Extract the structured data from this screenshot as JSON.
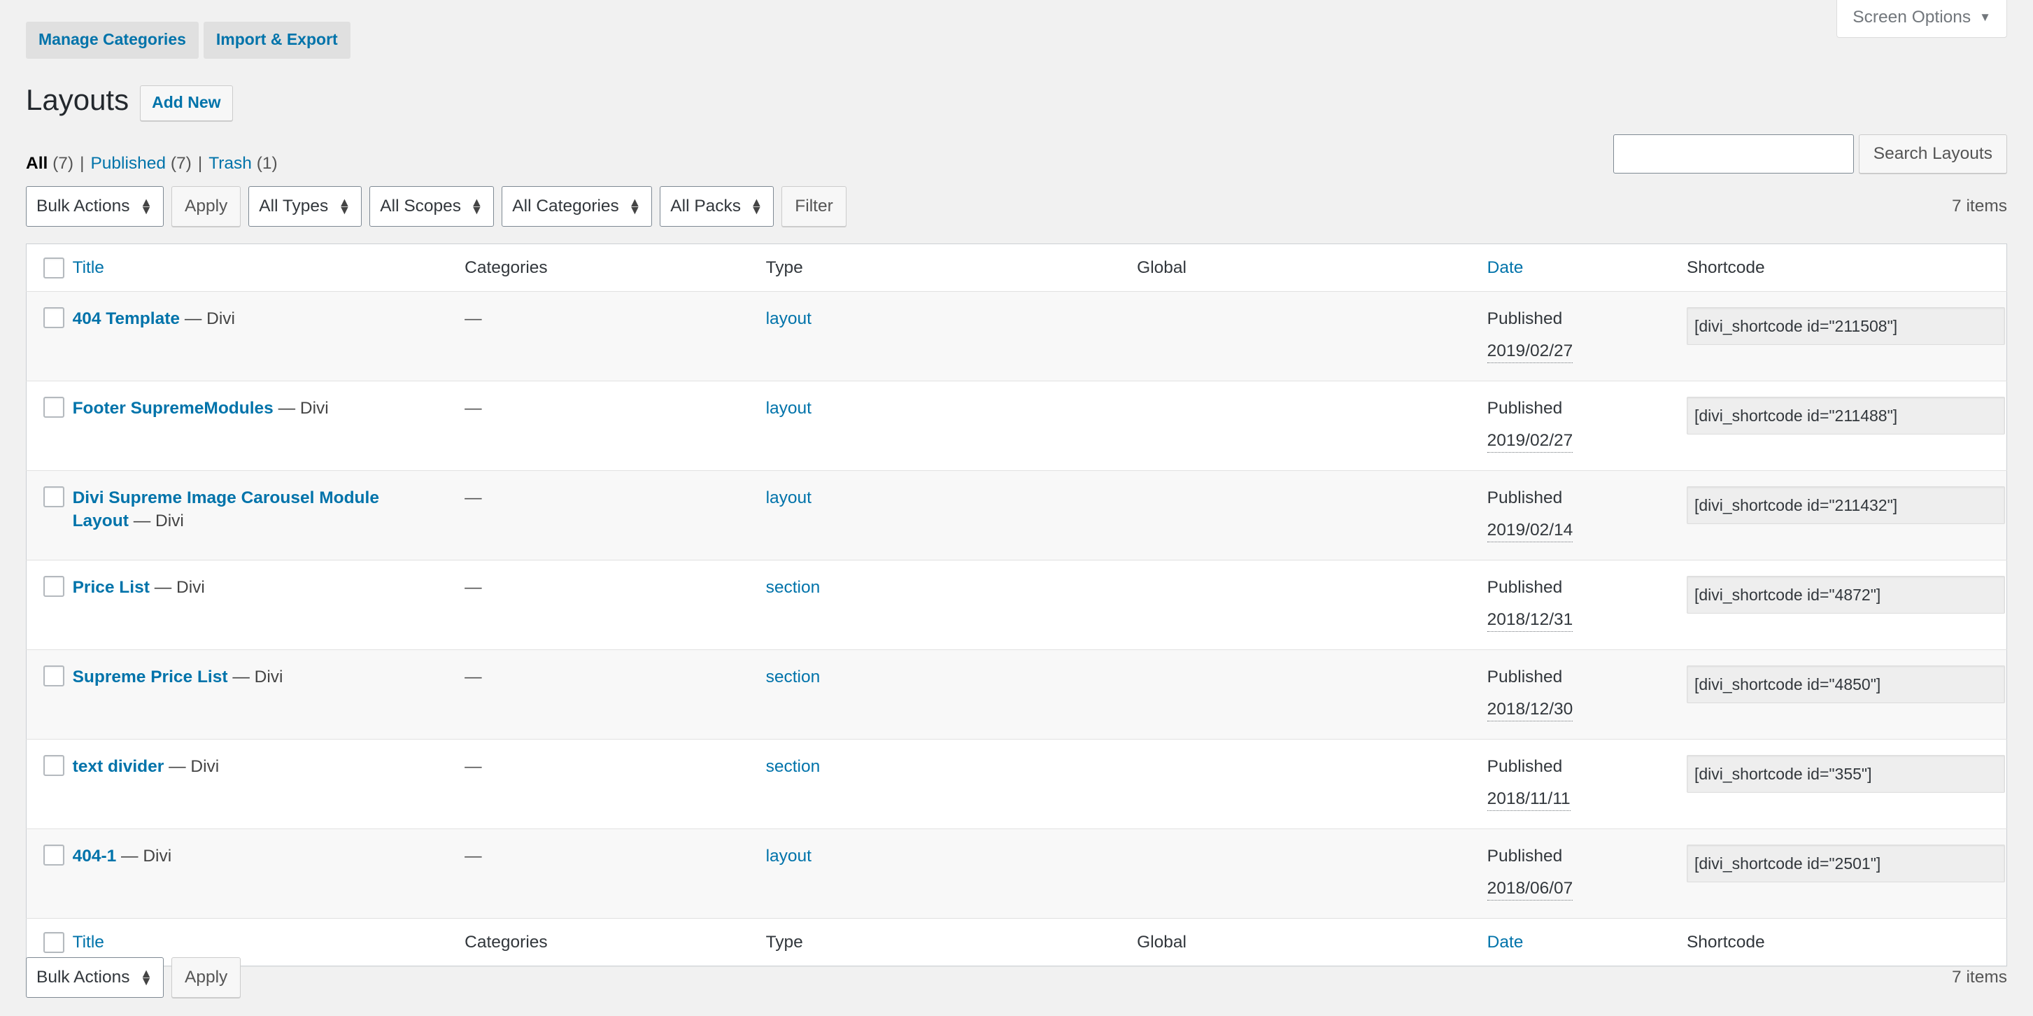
{
  "screen_options": {
    "label": "Screen Options",
    "caret": "▼"
  },
  "top_actions": [
    {
      "label": "Manage Categories",
      "name": "manage-categories-button"
    },
    {
      "label": "Import & Export",
      "name": "import-export-button"
    }
  ],
  "page_title": "Layouts",
  "add_new_label": "Add New",
  "status_links": [
    {
      "label": "All",
      "count": "(7)",
      "current": true
    },
    {
      "label": "Published",
      "count": "(7)",
      "current": false
    },
    {
      "label": "Trash",
      "count": "(1)",
      "current": false
    }
  ],
  "separator": "|",
  "search": {
    "value": "",
    "placeholder": "",
    "submit_label": "Search Layouts"
  },
  "tablenav_top": {
    "bulk_actions_label": "Bulk Actions",
    "apply_label": "Apply",
    "types_label": "All Types",
    "scopes_label": "All Scopes",
    "categories_label": "All Categories",
    "packs_label": "All Packs",
    "filter_label": "Filter",
    "item_count": "7 items"
  },
  "tablenav_bottom": {
    "bulk_actions_label": "Bulk Actions",
    "apply_label": "Apply",
    "item_count": "7 items"
  },
  "columns": {
    "title": "Title",
    "categories": "Categories",
    "type": "Type",
    "global": "Global",
    "date": "Date",
    "shortcode": "Shortcode"
  },
  "rows": [
    {
      "title": "404 Template",
      "post_state": "— Divi",
      "categories": "—",
      "type": "layout",
      "global": "",
      "date_status": "Published",
      "date_value": "2019/02/27",
      "shortcode": "[divi_shortcode id=\"211508\"]"
    },
    {
      "title": "Footer SupremeModules",
      "post_state": "— Divi",
      "categories": "—",
      "type": "layout",
      "global": "",
      "date_status": "Published",
      "date_value": "2019/02/27",
      "shortcode": "[divi_shortcode id=\"211488\"]"
    },
    {
      "title": "Divi Supreme Image Carousel Module Layout",
      "post_state": "— Divi",
      "categories": "—",
      "type": "layout",
      "global": "",
      "date_status": "Published",
      "date_value": "2019/02/14",
      "shortcode": "[divi_shortcode id=\"211432\"]"
    },
    {
      "title": "Price List",
      "post_state": "— Divi",
      "categories": "—",
      "type": "section",
      "global": "",
      "date_status": "Published",
      "date_value": "2018/12/31",
      "shortcode": "[divi_shortcode id=\"4872\"]"
    },
    {
      "title": "Supreme Price List",
      "post_state": "— Divi",
      "categories": "—",
      "type": "section",
      "global": "",
      "date_status": "Published",
      "date_value": "2018/12/30",
      "shortcode": "[divi_shortcode id=\"4850\"]"
    },
    {
      "title": "text divider",
      "post_state": "— Divi",
      "categories": "—",
      "type": "section",
      "global": "",
      "date_status": "Published",
      "date_value": "2018/11/11",
      "shortcode": "[divi_shortcode id=\"355\"]"
    },
    {
      "title": "404-1",
      "post_state": "— Divi",
      "categories": "—",
      "type": "layout",
      "global": "",
      "date_status": "Published",
      "date_value": "2018/06/07",
      "shortcode": "[divi_shortcode id=\"2501\"]"
    }
  ],
  "colors": {
    "link": "#0073aa",
    "page_bg": "#f1f1f1",
    "row_alt_bg": "#f8f8f8",
    "border": "#ccd0d4",
    "text": "#32373c"
  }
}
